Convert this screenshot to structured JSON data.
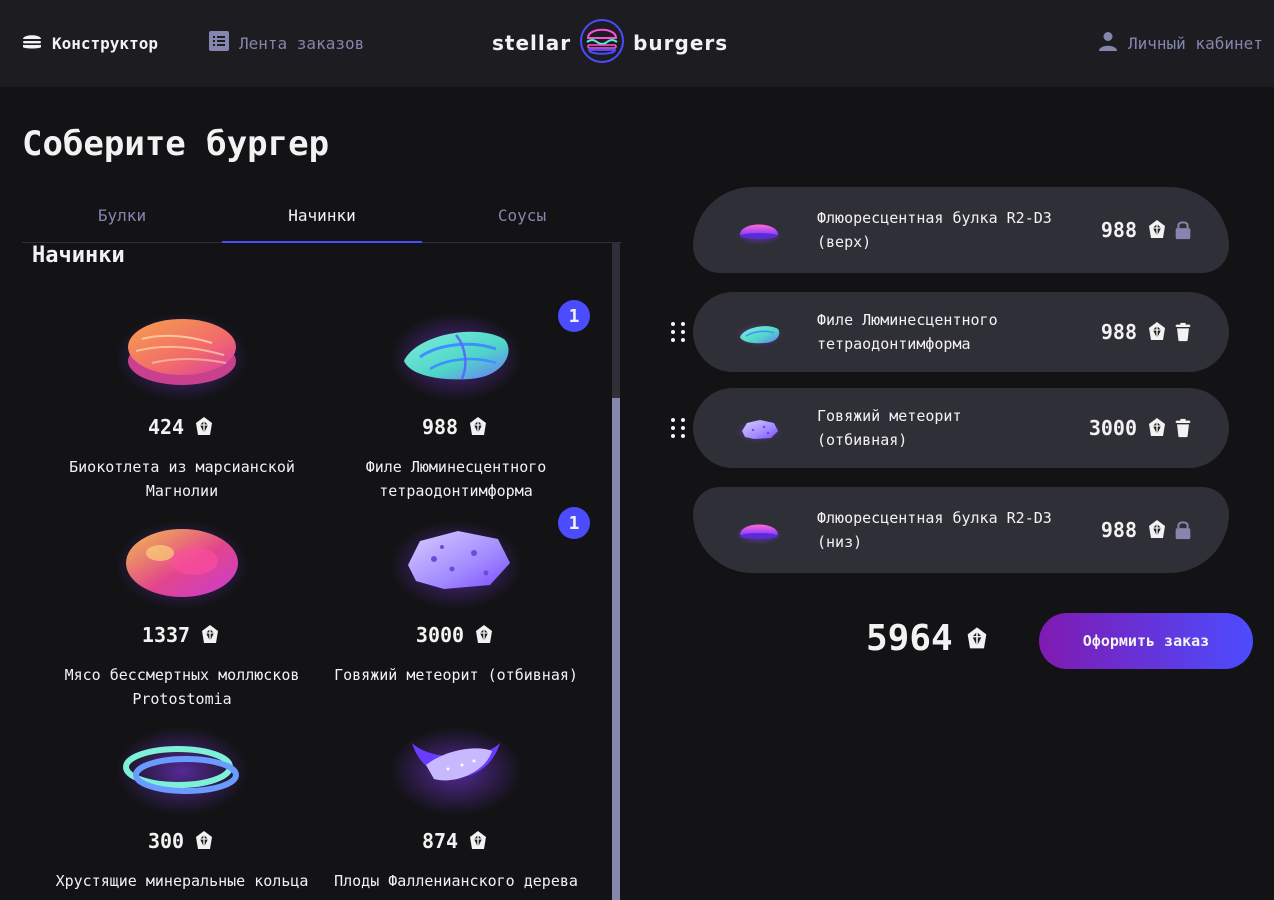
{
  "header": {
    "nav_constructor": "Конструктор",
    "nav_feed": "Лента заказов",
    "nav_profile": "Личный кабинет",
    "logo_left": "stellar",
    "logo_right": "burgers"
  },
  "page_title": "Соберите бургер",
  "tabs": [
    {
      "label": "Булки",
      "active": false
    },
    {
      "label": "Начинки",
      "active": true
    },
    {
      "label": "Соусы",
      "active": false
    }
  ],
  "section_title": "Начинки",
  "ingredients": [
    {
      "name": "Биокотлета из марсианской Магнолии",
      "price": "424",
      "count": null,
      "icon": "cutlet-icon"
    },
    {
      "name": "Филе Люминесцентного тетраодонтимформа",
      "price": "988",
      "count": "1",
      "icon": "fish-fillet-icon"
    },
    {
      "name": "Мясо бессмертных моллюсков Protostomia",
      "price": "1337",
      "count": null,
      "icon": "mollusk-meat-icon"
    },
    {
      "name": "Говяжий метеорит (отбивная)",
      "price": "3000",
      "count": "1",
      "icon": "meteorite-icon"
    },
    {
      "name": "Хрустящие минеральные кольца",
      "price": "300",
      "count": null,
      "icon": "mineral-rings-icon"
    },
    {
      "name": "Плоды Фалленианского дерева",
      "price": "874",
      "count": null,
      "icon": "fallenian-fruit-icon"
    }
  ],
  "constructor": {
    "top": {
      "name": "Флюоресцентная булка R2-D3 (верх)",
      "price": "988",
      "icon": "bun-icon",
      "action_icon": "lock-icon"
    },
    "fillings": [
      {
        "name": "Филе Люминесцентного тетраодонтимформа",
        "price": "988",
        "icon": "fish-fillet-icon",
        "action_icon": "trash-icon"
      },
      {
        "name": "Говяжий метеорит (отбивная)",
        "price": "3000",
        "icon": "meteorite-icon",
        "action_icon": "trash-icon"
      }
    ],
    "bottom": {
      "name": "Флюоресцентная булка R2-D3 (низ)",
      "price": "988",
      "icon": "bun-icon",
      "action_icon": "lock-icon"
    }
  },
  "total": "5964",
  "order_button": "Оформить заказ",
  "colors": {
    "background": "#131316",
    "header": "#1c1c21",
    "row": "#2f2f37",
    "accent": "#4c4cff",
    "inactive_text": "#8585ad",
    "gradient_start": "#801ab2",
    "gradient_end": "#4c4cff"
  }
}
